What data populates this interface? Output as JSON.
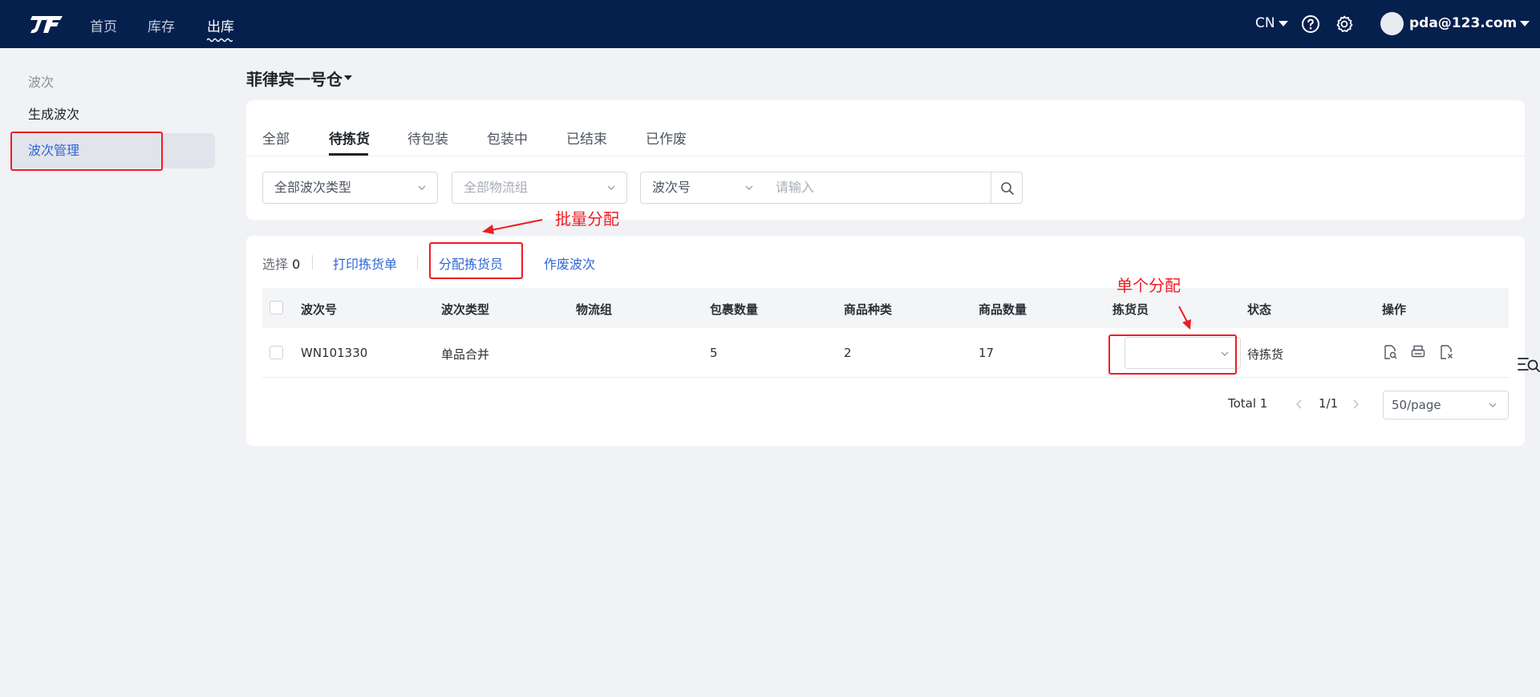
{
  "nav": {
    "logo": "JF",
    "items": [
      "首页",
      "库存",
      "出库"
    ],
    "lang": "CN",
    "user_email": "pda@123.com"
  },
  "sidebar": {
    "heading": "波次",
    "items": [
      "生成波次",
      "波次管理"
    ]
  },
  "warehouse": "菲律宾一号仓",
  "tabs": [
    "全部",
    "待拣货",
    "待包装",
    "包装中",
    "已结束",
    "已作废"
  ],
  "filters": {
    "wave_type": "全部波次类型",
    "logistics_group": "全部物流组",
    "search_field": "波次号",
    "search_placeholder": "请输入"
  },
  "toolbar": {
    "selected_label": "选择",
    "selected_count": "0",
    "print_label": "打印拣货单",
    "assign_label": "分配拣货员",
    "void_label": "作废波次"
  },
  "table": {
    "columns": [
      "波次号",
      "波次类型",
      "物流组",
      "包裹数量",
      "商品种类",
      "商品数量",
      "拣货员",
      "状态",
      "操作"
    ],
    "rows": [
      {
        "wave_no": "WN101330",
        "wave_type": "单品合并",
        "logistics_group": "",
        "packages": "5",
        "sku_types": "2",
        "qty": "17",
        "picker": "",
        "status": "待拣货"
      }
    ]
  },
  "pagination": {
    "total": "Total 1",
    "page": "1/1",
    "page_size": "50/page"
  },
  "annotations": {
    "batch_assign": "批量分配",
    "single_assign": "单个分配"
  },
  "colors": {
    "topbar": "#05204d",
    "link": "#2e66d6",
    "annotation": "#ee1c25"
  }
}
